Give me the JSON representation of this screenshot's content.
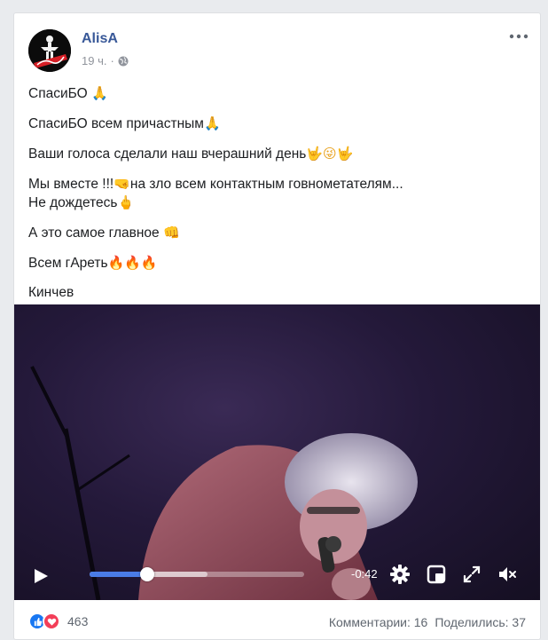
{
  "post": {
    "author": "AlisA",
    "time": "19 ч.",
    "separator": "·",
    "privacy_icon": "globe-icon",
    "lines": [
      {
        "text": "СпасиБО",
        "emoji": "🙏",
        "emoji_color": "#e8a21f"
      },
      {
        "text": "СпасиБО всем причастным",
        "emoji": "🙏",
        "emoji_color": "#e8a21f"
      },
      {
        "text": "Ваши голоса сделали наш вчерашний день",
        "emoji": "🤟😜🤟",
        "emoji_color": "#e8a21f"
      },
      {
        "text": "Мы вместе !!!",
        "emoji": "🤜",
        "text_after": "на зло всем контактным говнометателям...",
        "emoji_color": "#e8a21f"
      },
      {
        "text": "Не дождетесь",
        "emoji": "🖕",
        "emoji_color": "#e8a21f"
      },
      {
        "text": "А это самое главное ",
        "emoji": "👊",
        "emoji_color": "#e8a21f"
      },
      {
        "text": "Всем гАреть",
        "emoji": "🔥🔥🔥",
        "emoji_color": "#ef5a1d"
      },
      {
        "text": "Кинчев",
        "emoji": "",
        "emoji_color": "#e8a21f"
      }
    ]
  },
  "video": {
    "time_remaining": "-0:42",
    "progress_percent": 27,
    "buffered_percent": 55,
    "controls": {
      "play": "play-icon",
      "settings": "gear-icon",
      "pip": "picture-in-picture-icon",
      "fullscreen": "fullscreen-icon",
      "volume": "volume-muted-icon"
    },
    "accent_color": "#4a7ce6"
  },
  "footer": {
    "reaction_count": "463",
    "reaction_icons": [
      "like-icon",
      "love-icon"
    ],
    "comments": "Комментарии: 16",
    "shares": "Поделились: 37"
  }
}
